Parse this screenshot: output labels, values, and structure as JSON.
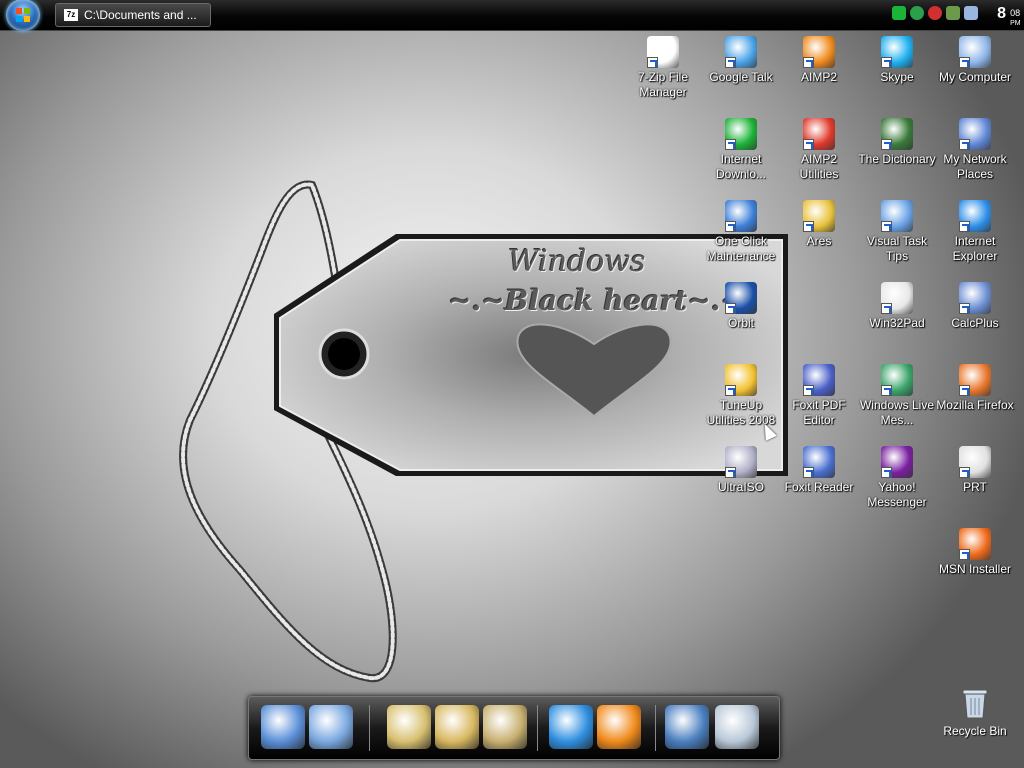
{
  "taskbar": {
    "task_button_label": "C:\\Documents and ...",
    "task_button_icon": "7z",
    "clock_hour": "8",
    "clock_minute": "08",
    "clock_ampm": "PM"
  },
  "wallpaper": {
    "title_line1": "Windows",
    "title_line2": "~.~Black heart~.~"
  },
  "desktop_icons": [
    {
      "label": "7-Zip File Manager",
      "icon": "7zip-icon",
      "color": "#ffffff"
    },
    {
      "label": "Google Talk",
      "icon": "google-talk-icon",
      "color": "#4aa3e8"
    },
    {
      "label": "AIMP2",
      "icon": "aimp-icon",
      "color": "#f08a1c"
    },
    {
      "label": "Skype",
      "icon": "skype-icon",
      "color": "#1eb0f0"
    },
    {
      "label": "My Computer",
      "icon": "computer-icon",
      "color": "#8fb6e8"
    },
    {
      "label": "Internet Downlo...",
      "icon": "idm-icon",
      "color": "#1bb338"
    },
    {
      "label": "AIMP2 Utilities",
      "icon": "aimp-utilities-icon",
      "color": "#e0382a"
    },
    {
      "label": "The Dictionary",
      "icon": "dictionary-icon",
      "color": "#3a7a3a"
    },
    {
      "label": "My Network Places",
      "icon": "network-icon",
      "color": "#5f86d6"
    },
    {
      "label": "One Click Maintenance",
      "icon": "maintenance-icon",
      "color": "#3d7fd8"
    },
    {
      "label": "Ares",
      "icon": "ares-icon",
      "color": "#e8c23a"
    },
    {
      "label": "Visual Task Tips",
      "icon": "task-tips-icon",
      "color": "#6aa3e6"
    },
    {
      "label": "Internet Explorer",
      "icon": "ie-icon",
      "color": "#2d8fe8"
    },
    {
      "label": "Orbit",
      "icon": "orbit-icon",
      "color": "#1a4fa8"
    },
    {
      "label": "Win32Pad",
      "icon": "notepad-icon",
      "color": "#e8e8e8"
    },
    {
      "label": "CalcPlus",
      "icon": "calculator-icon",
      "color": "#6c8fd4"
    },
    {
      "label": "TuneUp Utilities 2008",
      "icon": "tuneup-icon",
      "color": "#f2c230"
    },
    {
      "label": "Foxit PDF Editor",
      "icon": "foxit-editor-icon",
      "color": "#4a5fc8"
    },
    {
      "label": "Windows Live Mes...",
      "icon": "messenger-icon",
      "color": "#3aa56a"
    },
    {
      "label": "Mozilla Firefox",
      "icon": "firefox-icon",
      "color": "#e8762a"
    },
    {
      "label": "UltraISO",
      "icon": "ultraiso-icon",
      "color": "#b0b0c8"
    },
    {
      "label": "Foxit Reader",
      "icon": "foxit-reader-icon",
      "color": "#4a6fd0"
    },
    {
      "label": "Yahoo! Messenger",
      "icon": "yahoo-icon",
      "color": "#7a1fa0"
    },
    {
      "label": "PRT",
      "icon": "prt-icon",
      "color": "#e0e0e0"
    },
    {
      "label": "MSN Installer",
      "icon": "msn-icon",
      "color": "#f06a1a"
    }
  ],
  "dock": {
    "items": [
      {
        "icon": "computer-icon",
        "color": "#5a8fd8"
      },
      {
        "icon": "control-panel-icon",
        "color": "#7aa8e0"
      },
      {
        "icon": "folder-icon",
        "color": "#d8c070"
      },
      {
        "icon": "pictures-folder-icon",
        "color": "#d8b860"
      },
      {
        "icon": "music-folder-icon",
        "color": "#c8b070"
      },
      {
        "icon": "globe-icon",
        "color": "#2f8fe0"
      },
      {
        "icon": "media-player-icon",
        "color": "#f08a1c"
      },
      {
        "icon": "settings-gears-icon",
        "color": "#4a7fc0"
      },
      {
        "icon": "trash-icon",
        "color": "#b8c8d8"
      }
    ]
  },
  "recycle_bin": {
    "label": "Recycle Bin"
  }
}
